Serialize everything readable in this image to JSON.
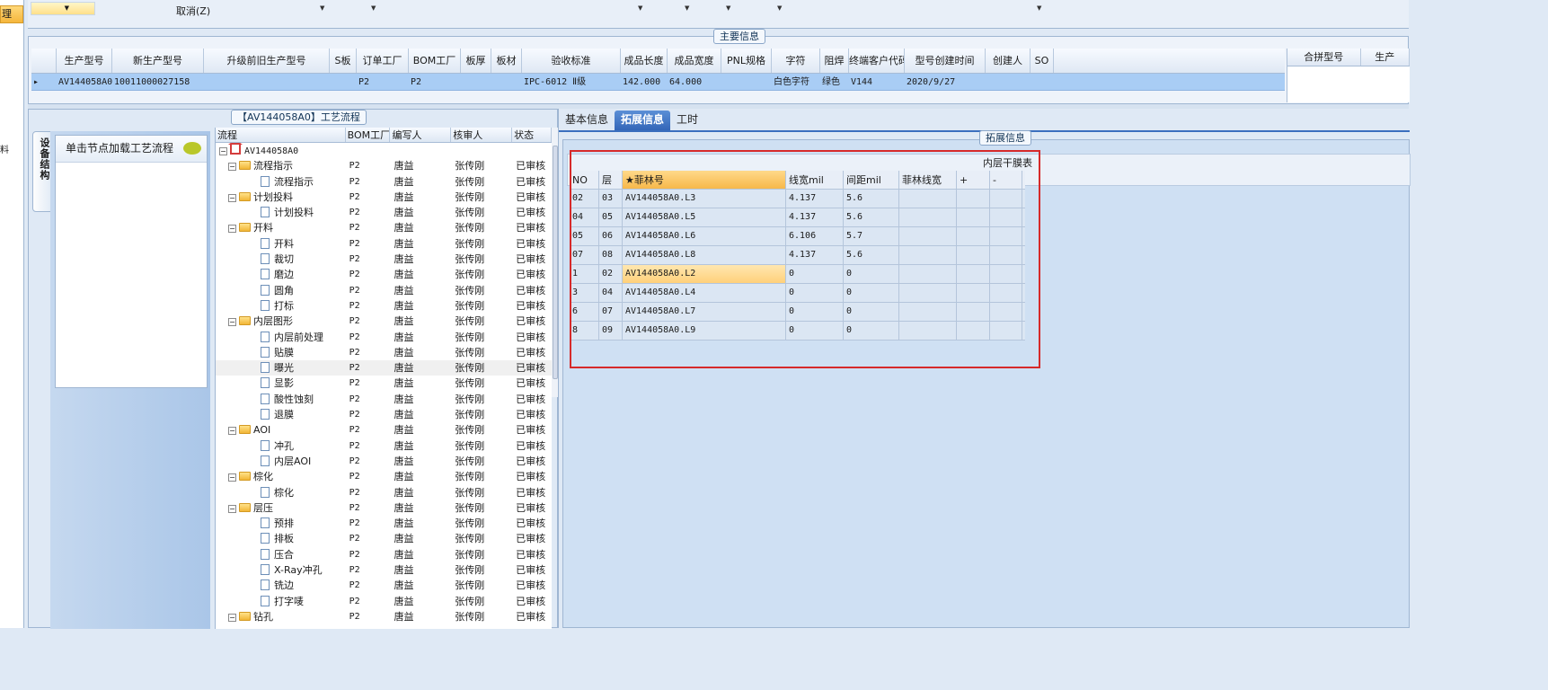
{
  "left_strip": {
    "selected_label": "理",
    "item_char": "料"
  },
  "toolbar": {
    "cancel_label": "取消(Z)"
  },
  "main_info": {
    "group_title": "主要信息",
    "columns": [
      "生产型号",
      "新生产型号",
      "升级前旧生产型号",
      "S板",
      "订单工厂",
      "BOM工厂",
      "板厚",
      "板材",
      "验收标准",
      "成品长度",
      "成品宽度",
      "PNL规格",
      "字符",
      "阻焊",
      "终端客户代码",
      "型号创建时间",
      "创建人",
      "SO"
    ],
    "row": [
      "AV144058A0",
      "10011000027158",
      "",
      "",
      "P2",
      "P2",
      "",
      "",
      "IPC-6012 Ⅱ级",
      "142.000",
      "64.000",
      "",
      "白色字符",
      "绿色",
      "V144",
      "2020/9/27",
      "",
      ""
    ],
    "merge_columns": [
      "合拼型号",
      "生产"
    ]
  },
  "process": {
    "group_title": "【AV144058A0】工艺流程",
    "vertical_tab": "设备结构",
    "load_hint": "单击节点加载工艺流程",
    "columns": [
      "流程",
      "BOM工厂",
      "编写人",
      "核审人",
      "状态"
    ],
    "rows": [
      {
        "level": 0,
        "type": "root",
        "name": "AV144058A0",
        "bom": "",
        "writer": "",
        "reviewer": "",
        "status": ""
      },
      {
        "level": 1,
        "type": "folder",
        "name": "流程指示",
        "bom": "P2",
        "writer": "唐益",
        "reviewer": "张传刚",
        "status": "已审核"
      },
      {
        "level": 2,
        "type": "doc",
        "name": "流程指示",
        "bom": "P2",
        "writer": "唐益",
        "reviewer": "张传刚",
        "status": "已审核"
      },
      {
        "level": 1,
        "type": "folder",
        "name": "计划投料",
        "bom": "P2",
        "writer": "唐益",
        "reviewer": "张传刚",
        "status": "已审核"
      },
      {
        "level": 2,
        "type": "doc",
        "name": "计划投料",
        "bom": "P2",
        "writer": "唐益",
        "reviewer": "张传刚",
        "status": "已审核"
      },
      {
        "level": 1,
        "type": "folder",
        "name": "开料",
        "bom": "P2",
        "writer": "唐益",
        "reviewer": "张传刚",
        "status": "已审核"
      },
      {
        "level": 2,
        "type": "doc",
        "name": "开料",
        "bom": "P2",
        "writer": "唐益",
        "reviewer": "张传刚",
        "status": "已审核"
      },
      {
        "level": 2,
        "type": "doc",
        "name": "裁切",
        "bom": "P2",
        "writer": "唐益",
        "reviewer": "张传刚",
        "status": "已审核"
      },
      {
        "level": 2,
        "type": "doc",
        "name": "磨边",
        "bom": "P2",
        "writer": "唐益",
        "reviewer": "张传刚",
        "status": "已审核"
      },
      {
        "level": 2,
        "type": "doc",
        "name": "圆角",
        "bom": "P2",
        "writer": "唐益",
        "reviewer": "张传刚",
        "status": "已审核"
      },
      {
        "level": 2,
        "type": "doc",
        "name": "打标",
        "bom": "P2",
        "writer": "唐益",
        "reviewer": "张传刚",
        "status": "已审核"
      },
      {
        "level": 1,
        "type": "folder",
        "name": "内层图形",
        "bom": "P2",
        "writer": "唐益",
        "reviewer": "张传刚",
        "status": "已审核"
      },
      {
        "level": 2,
        "type": "doc",
        "name": "内层前处理",
        "bom": "P2",
        "writer": "唐益",
        "reviewer": "张传刚",
        "status": "已审核"
      },
      {
        "level": 2,
        "type": "doc",
        "name": "贴膜",
        "bom": "P2",
        "writer": "唐益",
        "reviewer": "张传刚",
        "status": "已审核"
      },
      {
        "level": 2,
        "type": "doc",
        "name": "曝光",
        "bom": "P2",
        "writer": "唐益",
        "reviewer": "张传刚",
        "status": "已审核",
        "highlight": true
      },
      {
        "level": 2,
        "type": "doc",
        "name": "显影",
        "bom": "P2",
        "writer": "唐益",
        "reviewer": "张传刚",
        "status": "已审核"
      },
      {
        "level": 2,
        "type": "doc",
        "name": "酸性蚀刻",
        "bom": "P2",
        "writer": "唐益",
        "reviewer": "张传刚",
        "status": "已审核"
      },
      {
        "level": 2,
        "type": "doc",
        "name": "退膜",
        "bom": "P2",
        "writer": "唐益",
        "reviewer": "张传刚",
        "status": "已审核"
      },
      {
        "level": 1,
        "type": "folder",
        "name": "AOI",
        "bom": "P2",
        "writer": "唐益",
        "reviewer": "张传刚",
        "status": "已审核"
      },
      {
        "level": 2,
        "type": "doc",
        "name": "冲孔",
        "bom": "P2",
        "writer": "唐益",
        "reviewer": "张传刚",
        "status": "已审核"
      },
      {
        "level": 2,
        "type": "doc",
        "name": "内层AOI",
        "bom": "P2",
        "writer": "唐益",
        "reviewer": "张传刚",
        "status": "已审核"
      },
      {
        "level": 1,
        "type": "folder",
        "name": "棕化",
        "bom": "P2",
        "writer": "唐益",
        "reviewer": "张传刚",
        "status": "已审核"
      },
      {
        "level": 2,
        "type": "doc",
        "name": "棕化",
        "bom": "P2",
        "writer": "唐益",
        "reviewer": "张传刚",
        "status": "已审核"
      },
      {
        "level": 1,
        "type": "folder",
        "name": "层压",
        "bom": "P2",
        "writer": "唐益",
        "reviewer": "张传刚",
        "status": "已审核"
      },
      {
        "level": 2,
        "type": "doc",
        "name": "预排",
        "bom": "P2",
        "writer": "唐益",
        "reviewer": "张传刚",
        "status": "已审核"
      },
      {
        "level": 2,
        "type": "doc",
        "name": "排板",
        "bom": "P2",
        "writer": "唐益",
        "reviewer": "张传刚",
        "status": "已审核"
      },
      {
        "level": 2,
        "type": "doc",
        "name": "压合",
        "bom": "P2",
        "writer": "唐益",
        "reviewer": "张传刚",
        "status": "已审核"
      },
      {
        "level": 2,
        "type": "doc",
        "name": "X-Ray冲孔",
        "bom": "P2",
        "writer": "唐益",
        "reviewer": "张传刚",
        "status": "已审核"
      },
      {
        "level": 2,
        "type": "doc",
        "name": "铣边",
        "bom": "P2",
        "writer": "唐益",
        "reviewer": "张传刚",
        "status": "已审核"
      },
      {
        "level": 2,
        "type": "doc",
        "name": "打字唛",
        "bom": "P2",
        "writer": "唐益",
        "reviewer": "张传刚",
        "status": "已审核"
      },
      {
        "level": 1,
        "type": "folder",
        "name": "钻孔",
        "bom": "P2",
        "writer": "唐益",
        "reviewer": "张传刚",
        "status": "已审核"
      }
    ]
  },
  "tabs": [
    {
      "label": "基本信息",
      "active": false
    },
    {
      "label": "拓展信息",
      "active": true
    },
    {
      "label": "工时",
      "active": false
    }
  ],
  "extended": {
    "group_title": "拓展信息",
    "inner_title": "内层干膜表",
    "columns": [
      "NO",
      "层",
      "★菲林号",
      "线宽mil",
      "间距mil",
      "菲林线宽",
      "+",
      "-"
    ],
    "rows": [
      [
        "02",
        "03",
        "AV144058A0.L3",
        "4.137",
        "5.6",
        "",
        "",
        ""
      ],
      [
        "04",
        "05",
        "AV144058A0.L5",
        "4.137",
        "5.6",
        "",
        "",
        ""
      ],
      [
        "05",
        "06",
        "AV144058A0.L6",
        "6.106",
        "5.7",
        "",
        "",
        ""
      ],
      [
        "07",
        "08",
        "AV144058A0.L8",
        "4.137",
        "5.6",
        "",
        "",
        ""
      ],
      [
        "1",
        "02",
        "AV144058A0.L2",
        "0",
        "0",
        "",
        "",
        ""
      ],
      [
        "3",
        "04",
        "AV144058A0.L4",
        "0",
        "0",
        "",
        "",
        ""
      ],
      [
        "6",
        "07",
        "AV144058A0.L7",
        "0",
        "0",
        "",
        "",
        ""
      ],
      [
        "8",
        "09",
        "AV144058A0.L9",
        "0",
        "0",
        "",
        "",
        ""
      ]
    ],
    "current_row": 4
  },
  "colors": {
    "highlight_border": "#d62a2a",
    "active_tab": "#3366b8",
    "selected_row": "#a9cdf5"
  }
}
